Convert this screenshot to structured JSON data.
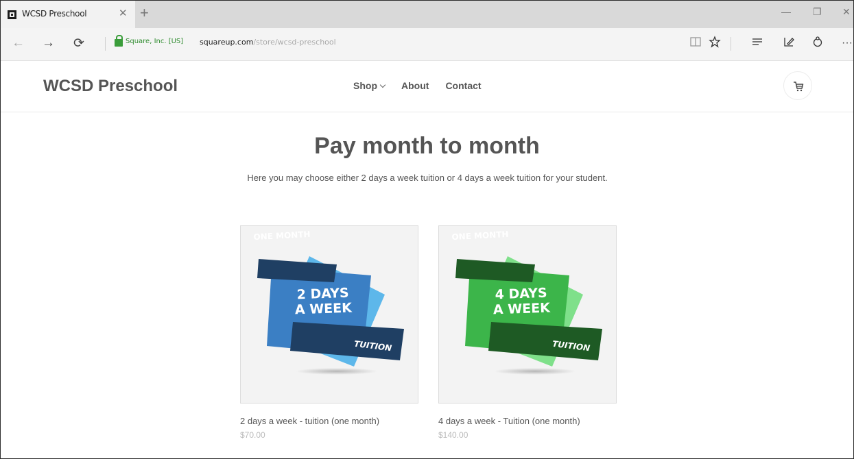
{
  "browser": {
    "tab_title": "WCSD Preschool",
    "tab_close": "✕",
    "new_tab": "+",
    "window_minimize": "—",
    "window_restore": "❐",
    "window_close": "✕",
    "back": "←",
    "forward": "→",
    "refresh": "⟳",
    "site_identity": "Square, Inc. [US]",
    "url_domain": "squareup.com",
    "url_path": "/store/wcsd-preschool",
    "icons": [
      "reading-view-icon",
      "favorite-star-icon",
      "hub-icon",
      "web-note-icon",
      "share-icon",
      "more-icon"
    ],
    "more": "···"
  },
  "site": {
    "brand": "WCSD Preschool",
    "nav": {
      "shop": "Shop",
      "about": "About",
      "contact": "Contact"
    }
  },
  "main": {
    "title": "Pay month to month",
    "description": "Here you may choose either 2 days a week tuition or 4 days a week tuition for your student."
  },
  "products": [
    {
      "badge_top": "ONE MONTH",
      "badge_line1": "2 DAYS",
      "badge_line2": "A WEEK",
      "badge_bottom": "TUITION",
      "name": "2 days a week - tuition (one month)",
      "price": "$70.00",
      "colors": {
        "light": "#5db7ea",
        "main": "#3b7fc4",
        "dark": "#1f3f63"
      }
    },
    {
      "badge_top": "ONE MONTH",
      "badge_line1": "4 DAYS",
      "badge_line2": "A WEEK",
      "badge_bottom": "TUITION",
      "name": "4 days a week - Tuition (one month)",
      "price": "$140.00",
      "colors": {
        "light": "#7fe08a",
        "main": "#3cb54a",
        "dark": "#1e5a24"
      }
    }
  ]
}
